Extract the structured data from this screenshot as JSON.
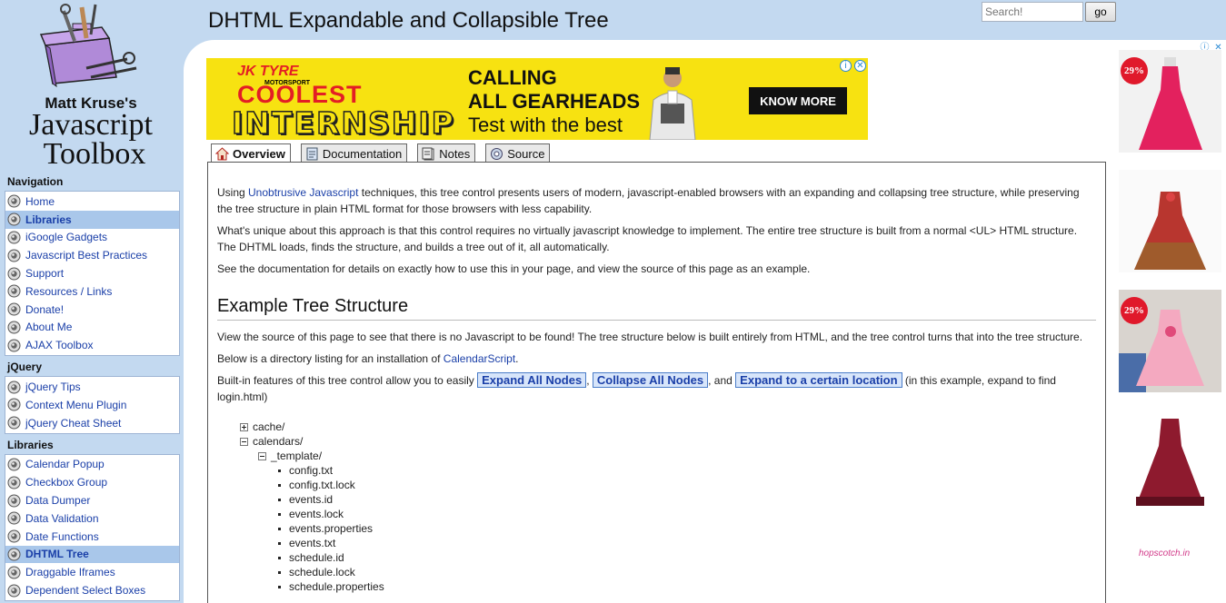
{
  "logo": {
    "line1": "Matt Kruse's",
    "line2": "Javascript",
    "line3": "Toolbox"
  },
  "header": {
    "title": "DHTML Expandable and Collapsible Tree"
  },
  "search": {
    "placeholder": "Search!",
    "button_label": "go"
  },
  "sidebar": {
    "sections": [
      {
        "title": "Navigation",
        "items": [
          {
            "label": "Home",
            "active": false
          },
          {
            "label": "Libraries",
            "active": true
          },
          {
            "label": "iGoogle Gadgets",
            "active": false
          },
          {
            "label": "Javascript Best Practices",
            "active": false
          },
          {
            "label": "Support",
            "active": false
          },
          {
            "label": "Resources / Links",
            "active": false
          },
          {
            "label": "Donate!",
            "active": false
          },
          {
            "label": "About Me",
            "active": false
          },
          {
            "label": "AJAX Toolbox",
            "active": false
          }
        ]
      },
      {
        "title": "jQuery",
        "items": [
          {
            "label": "jQuery Tips",
            "active": false
          },
          {
            "label": "Context Menu Plugin",
            "active": false
          },
          {
            "label": "jQuery Cheat Sheet",
            "active": false
          }
        ]
      },
      {
        "title": "Libraries",
        "items": [
          {
            "label": "Calendar Popup",
            "active": false
          },
          {
            "label": "Checkbox Group",
            "active": false
          },
          {
            "label": "Data Dumper",
            "active": false
          },
          {
            "label": "Data Validation",
            "active": false
          },
          {
            "label": "Date Functions",
            "active": false
          },
          {
            "label": "DHTML Tree",
            "active": true
          },
          {
            "label": "Draggable Iframes",
            "active": false
          },
          {
            "label": "Dependent Select Boxes",
            "active": false
          }
        ]
      }
    ]
  },
  "ad": {
    "brand": "JK TYRE",
    "brand_sub": "MOTORSPORT",
    "headline1": "COOLEST",
    "headline2": "INTERNSHIP",
    "line1": "CALLING",
    "line2": "ALL GEARHEADS",
    "line3": "Test with the best",
    "cta": "KNOW MORE",
    "colors": {
      "background": "#f7e211",
      "accent": "#e31e25"
    }
  },
  "tabs": [
    {
      "label": "Overview",
      "icon": "home-icon",
      "active": true
    },
    {
      "label": "Documentation",
      "icon": "document-icon",
      "active": false
    },
    {
      "label": "Notes",
      "icon": "notes-icon",
      "active": false
    },
    {
      "label": "Source",
      "icon": "source-icon",
      "active": false
    }
  ],
  "content": {
    "p1_before": "Using ",
    "p1_link": "Unobtrusive Javascript",
    "p1_after": " techniques, this tree control presents users of modern, javascript-enabled browsers with an expanding and collapsing tree structure, while preserving the tree structure in plain HTML format for those browsers with less capability.",
    "p2": "What's unique about this approach is that this control requires no virtually javascript knowledge to implement. The entire tree structure is built from a normal <UL> HTML structure. The DHTML loads, finds the structure, and builds a tree out of it, all automatically.",
    "p3": "See the documentation for details on exactly how to use this in your page, and view the source of this page as an example.",
    "heading": "Example Tree Structure",
    "p4": "View the source of this page to see that there is no Javascript to be found! The tree structure below is built entirely from HTML, and the tree control turns that into the tree structure.",
    "p5_before": "Below is a directory listing for an installation of ",
    "p5_link": "CalendarScript",
    "p5_after": ".",
    "p6_before": "Built-in features of this tree control allow you to easily ",
    "btn_expand_all": "Expand All Nodes",
    "sep1": ", ",
    "btn_collapse_all": "Collapse All Nodes",
    "sep2": ", and ",
    "btn_expand_to": "Expand to a certain location",
    "p6_after": " (in this example, expand to find login.html)"
  },
  "tree": [
    {
      "label": "cache/",
      "level": 0,
      "type": "plus"
    },
    {
      "label": "calendars/",
      "level": 0,
      "type": "minus"
    },
    {
      "label": "_template/",
      "level": 1,
      "type": "minus"
    },
    {
      "label": "config.txt",
      "level": 2,
      "type": "leaf"
    },
    {
      "label": "config.txt.lock",
      "level": 2,
      "type": "leaf"
    },
    {
      "label": "events.id",
      "level": 2,
      "type": "leaf"
    },
    {
      "label": "events.lock",
      "level": 2,
      "type": "leaf"
    },
    {
      "label": "events.properties",
      "level": 2,
      "type": "leaf"
    },
    {
      "label": "events.txt",
      "level": 2,
      "type": "leaf"
    },
    {
      "label": "schedule.id",
      "level": 2,
      "type": "leaf"
    },
    {
      "label": "schedule.lock",
      "level": 2,
      "type": "leaf"
    },
    {
      "label": "schedule.properties",
      "level": 2,
      "type": "leaf"
    }
  ],
  "right_ads": {
    "badges": [
      "29%",
      "29%"
    ],
    "store": "hopscotch.in"
  }
}
